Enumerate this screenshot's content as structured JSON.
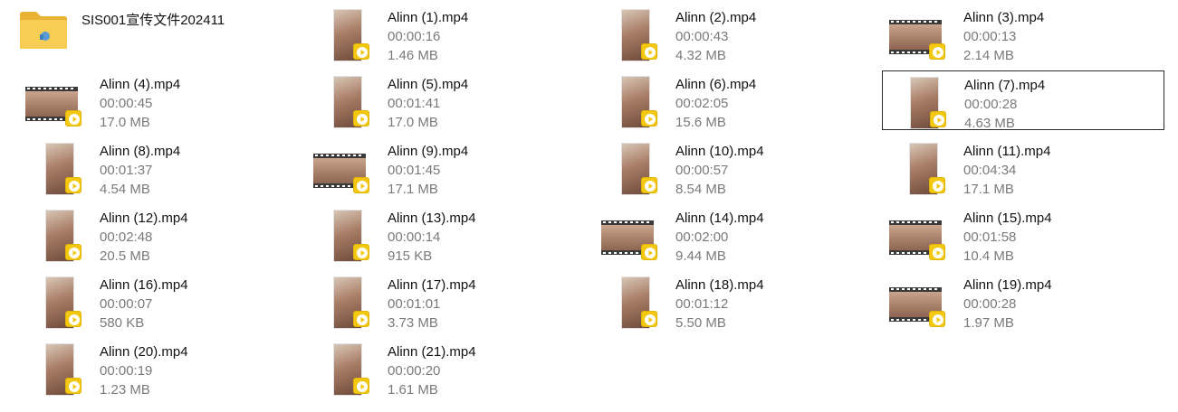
{
  "folder": {
    "name": "SIS001宣传文件202411",
    "icon": "folder-icon"
  },
  "colors": {
    "badge": "#f2c811",
    "folder": "#f5c94a",
    "selection_border": "#2b2b2b"
  },
  "selected_file": "Alinn (7).mp4",
  "files": [
    {
      "name": "Alinn (1).mp4",
      "duration": "00:00:16",
      "size": "1.46 MB",
      "thumb": "portrait"
    },
    {
      "name": "Alinn (2).mp4",
      "duration": "00:00:43",
      "size": "4.32 MB",
      "thumb": "portrait"
    },
    {
      "name": "Alinn (3).mp4",
      "duration": "00:00:13",
      "size": "2.14 MB",
      "thumb": "landscape"
    },
    {
      "name": "Alinn (4).mp4",
      "duration": "00:00:45",
      "size": "17.0 MB",
      "thumb": "landscape"
    },
    {
      "name": "Alinn (5).mp4",
      "duration": "00:01:41",
      "size": "17.0 MB",
      "thumb": "portrait"
    },
    {
      "name": "Alinn (6).mp4",
      "duration": "00:02:05",
      "size": "15.6 MB",
      "thumb": "portrait"
    },
    {
      "name": "Alinn (7).mp4",
      "duration": "00:00:28",
      "size": "4.63 MB",
      "thumb": "portrait"
    },
    {
      "name": "Alinn (8).mp4",
      "duration": "00:01:37",
      "size": "4.54 MB",
      "thumb": "portrait"
    },
    {
      "name": "Alinn (9).mp4",
      "duration": "00:01:45",
      "size": "17.1 MB",
      "thumb": "landscape"
    },
    {
      "name": "Alinn (10).mp4",
      "duration": "00:00:57",
      "size": "8.54 MB",
      "thumb": "portrait"
    },
    {
      "name": "Alinn (11).mp4",
      "duration": "00:04:34",
      "size": "17.1 MB",
      "thumb": "portrait"
    },
    {
      "name": "Alinn (12).mp4",
      "duration": "00:02:48",
      "size": "20.5 MB",
      "thumb": "portrait"
    },
    {
      "name": "Alinn (13).mp4",
      "duration": "00:00:14",
      "size": "915 KB",
      "thumb": "portrait"
    },
    {
      "name": "Alinn (14).mp4",
      "duration": "00:02:00",
      "size": "9.44 MB",
      "thumb": "landscape"
    },
    {
      "name": "Alinn (15).mp4",
      "duration": "00:01:58",
      "size": "10.4 MB",
      "thumb": "landscape"
    },
    {
      "name": "Alinn (16).mp4",
      "duration": "00:00:07",
      "size": "580 KB",
      "thumb": "portrait"
    },
    {
      "name": "Alinn (17).mp4",
      "duration": "00:01:01",
      "size": "3.73 MB",
      "thumb": "portrait"
    },
    {
      "name": "Alinn (18).mp4",
      "duration": "00:01:12",
      "size": "5.50 MB",
      "thumb": "portrait"
    },
    {
      "name": "Alinn (19).mp4",
      "duration": "00:00:28",
      "size": "1.97 MB",
      "thumb": "landscape"
    },
    {
      "name": "Alinn (20).mp4",
      "duration": "00:00:19",
      "size": "1.23 MB",
      "thumb": "portrait"
    },
    {
      "name": "Alinn (21).mp4",
      "duration": "00:00:20",
      "size": "1.61 MB",
      "thumb": "portrait"
    }
  ]
}
